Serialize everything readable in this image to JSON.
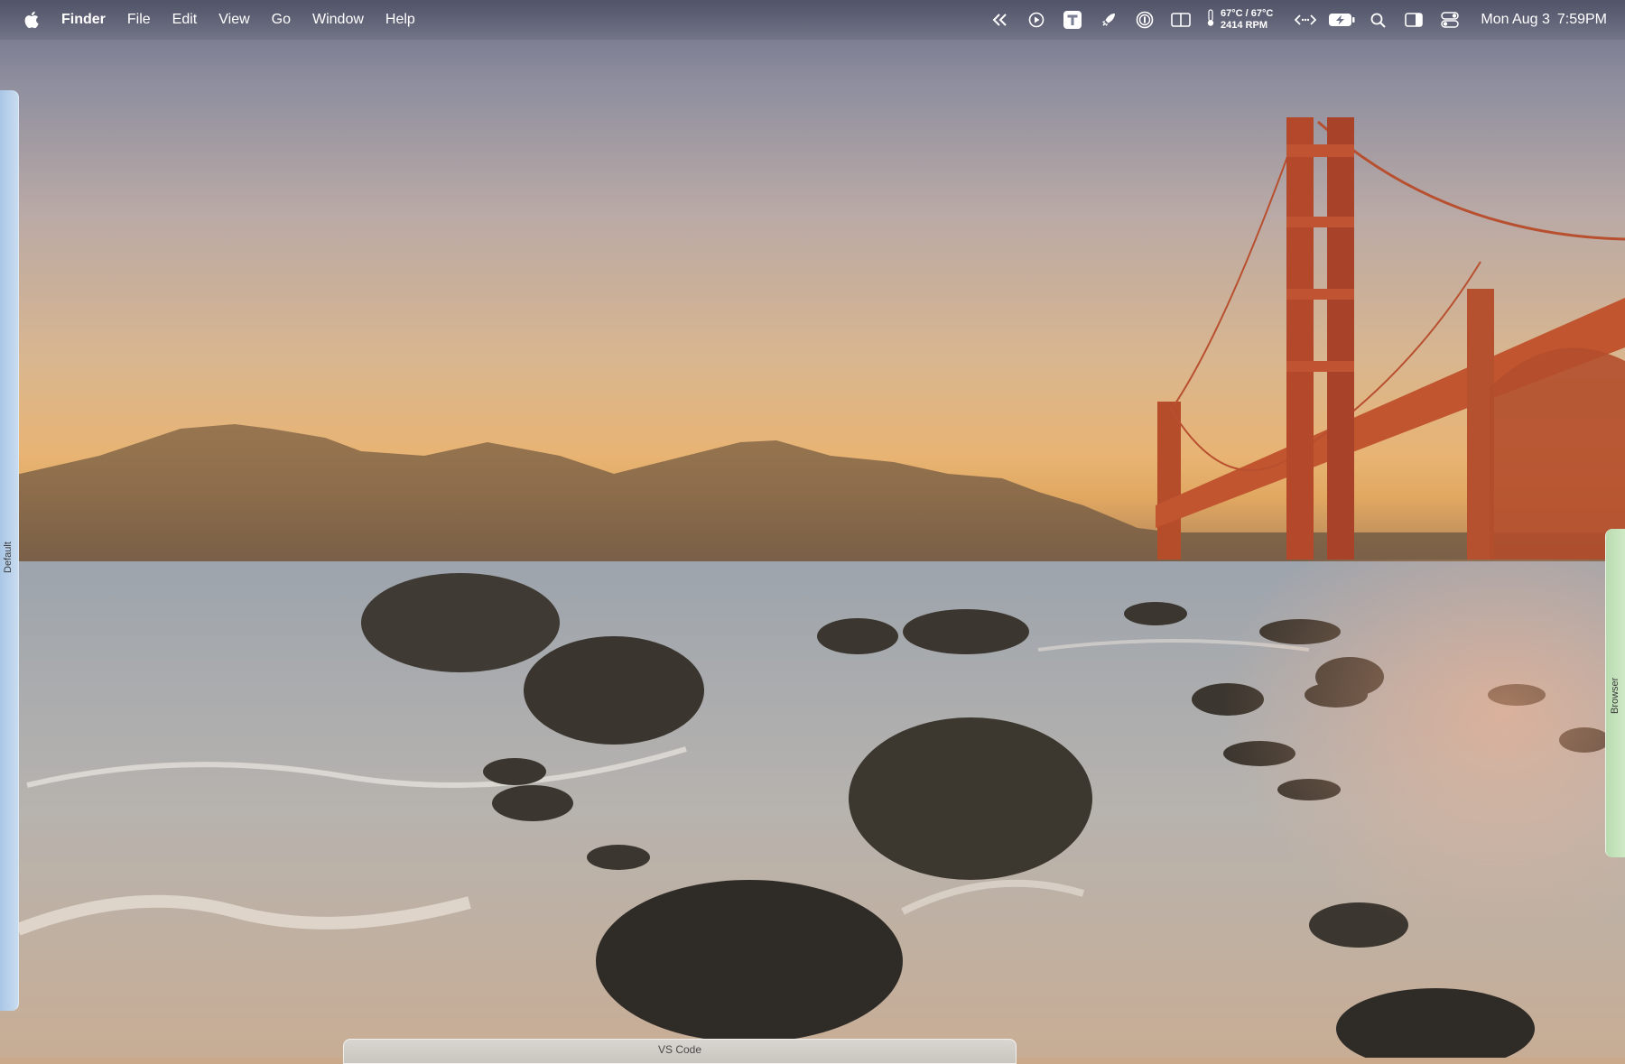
{
  "menubar": {
    "app_name": "Finder",
    "menus": [
      "File",
      "Edit",
      "View",
      "Go",
      "Window",
      "Help"
    ],
    "system_stats": {
      "temperature": "67°C / 67°C",
      "fan": "2414 RPM"
    },
    "clock": {
      "date": "Mon Aug 3",
      "time": "7:59PM"
    },
    "tray_icons": [
      "rewind-icon",
      "play-icon",
      "text-app-icon",
      "rocket-icon",
      "password-manager-icon",
      "split-view-icon",
      "thermometer-icon",
      "code-brackets-icon",
      "battery-charging-icon",
      "spotlight-search-icon",
      "sidebar-icon",
      "control-center-icon"
    ]
  },
  "spaces": {
    "left": "Default",
    "right": "Browser",
    "bottom": "VS Code"
  }
}
